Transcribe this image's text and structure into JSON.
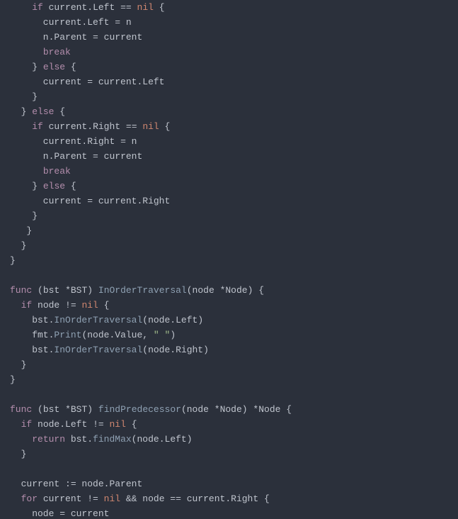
{
  "code_lines": [
    [
      {
        "cls": "tok-id",
        "txt": "    "
      },
      {
        "cls": "tok-kw",
        "txt": "if"
      },
      {
        "cls": "tok-id",
        "txt": " current"
      },
      {
        "cls": "tok-pun",
        "txt": "."
      },
      {
        "cls": "tok-prop",
        "txt": "Left"
      },
      {
        "cls": "tok-id",
        "txt": " "
      },
      {
        "cls": "tok-op",
        "txt": "=="
      },
      {
        "cls": "tok-id",
        "txt": " "
      },
      {
        "cls": "tok-nil",
        "txt": "nil"
      },
      {
        "cls": "tok-id",
        "txt": " "
      },
      {
        "cls": "tok-pun",
        "txt": "{"
      }
    ],
    [
      {
        "cls": "tok-id",
        "txt": "      current"
      },
      {
        "cls": "tok-pun",
        "txt": "."
      },
      {
        "cls": "tok-prop",
        "txt": "Left"
      },
      {
        "cls": "tok-id",
        "txt": " "
      },
      {
        "cls": "tok-op",
        "txt": "="
      },
      {
        "cls": "tok-id",
        "txt": " n"
      }
    ],
    [
      {
        "cls": "tok-id",
        "txt": "      n"
      },
      {
        "cls": "tok-pun",
        "txt": "."
      },
      {
        "cls": "tok-prop",
        "txt": "Parent"
      },
      {
        "cls": "tok-id",
        "txt": " "
      },
      {
        "cls": "tok-op",
        "txt": "="
      },
      {
        "cls": "tok-id",
        "txt": " current"
      }
    ],
    [
      {
        "cls": "tok-id",
        "txt": "      "
      },
      {
        "cls": "tok-kw",
        "txt": "break"
      }
    ],
    [
      {
        "cls": "tok-id",
        "txt": "    "
      },
      {
        "cls": "tok-pun",
        "txt": "}"
      },
      {
        "cls": "tok-id",
        "txt": " "
      },
      {
        "cls": "tok-kw",
        "txt": "else"
      },
      {
        "cls": "tok-id",
        "txt": " "
      },
      {
        "cls": "tok-pun",
        "txt": "{"
      }
    ],
    [
      {
        "cls": "tok-id",
        "txt": "      current "
      },
      {
        "cls": "tok-op",
        "txt": "="
      },
      {
        "cls": "tok-id",
        "txt": " current"
      },
      {
        "cls": "tok-pun",
        "txt": "."
      },
      {
        "cls": "tok-prop",
        "txt": "Left"
      }
    ],
    [
      {
        "cls": "tok-id",
        "txt": "    "
      },
      {
        "cls": "tok-pun",
        "txt": "}"
      }
    ],
    [
      {
        "cls": "tok-id",
        "txt": "  "
      },
      {
        "cls": "tok-pun",
        "txt": "}"
      },
      {
        "cls": "tok-id",
        "txt": " "
      },
      {
        "cls": "tok-kw",
        "txt": "else"
      },
      {
        "cls": "tok-id",
        "txt": " "
      },
      {
        "cls": "tok-pun",
        "txt": "{"
      }
    ],
    [
      {
        "cls": "tok-id",
        "txt": "    "
      },
      {
        "cls": "tok-kw",
        "txt": "if"
      },
      {
        "cls": "tok-id",
        "txt": " current"
      },
      {
        "cls": "tok-pun",
        "txt": "."
      },
      {
        "cls": "tok-prop",
        "txt": "Right"
      },
      {
        "cls": "tok-id",
        "txt": " "
      },
      {
        "cls": "tok-op",
        "txt": "=="
      },
      {
        "cls": "tok-id",
        "txt": " "
      },
      {
        "cls": "tok-nil",
        "txt": "nil"
      },
      {
        "cls": "tok-id",
        "txt": " "
      },
      {
        "cls": "tok-pun",
        "txt": "{"
      }
    ],
    [
      {
        "cls": "tok-id",
        "txt": "      current"
      },
      {
        "cls": "tok-pun",
        "txt": "."
      },
      {
        "cls": "tok-prop",
        "txt": "Right"
      },
      {
        "cls": "tok-id",
        "txt": " "
      },
      {
        "cls": "tok-op",
        "txt": "="
      },
      {
        "cls": "tok-id",
        "txt": " n"
      }
    ],
    [
      {
        "cls": "tok-id",
        "txt": "      n"
      },
      {
        "cls": "tok-pun",
        "txt": "."
      },
      {
        "cls": "tok-prop",
        "txt": "Parent"
      },
      {
        "cls": "tok-id",
        "txt": " "
      },
      {
        "cls": "tok-op",
        "txt": "="
      },
      {
        "cls": "tok-id",
        "txt": " current"
      }
    ],
    [
      {
        "cls": "tok-id",
        "txt": "      "
      },
      {
        "cls": "tok-kw",
        "txt": "break"
      }
    ],
    [
      {
        "cls": "tok-id",
        "txt": "    "
      },
      {
        "cls": "tok-pun",
        "txt": "}"
      },
      {
        "cls": "tok-id",
        "txt": " "
      },
      {
        "cls": "tok-kw",
        "txt": "else"
      },
      {
        "cls": "tok-id",
        "txt": " "
      },
      {
        "cls": "tok-pun",
        "txt": "{"
      }
    ],
    [
      {
        "cls": "tok-id",
        "txt": "      current "
      },
      {
        "cls": "tok-op",
        "txt": "="
      },
      {
        "cls": "tok-id",
        "txt": " current"
      },
      {
        "cls": "tok-pun",
        "txt": "."
      },
      {
        "cls": "tok-prop",
        "txt": "Right"
      }
    ],
    [
      {
        "cls": "tok-id",
        "txt": "    "
      },
      {
        "cls": "tok-pun",
        "txt": "}"
      }
    ],
    [
      {
        "cls": "tok-id",
        "txt": "   "
      },
      {
        "cls": "tok-pun",
        "txt": "}"
      }
    ],
    [
      {
        "cls": "tok-id",
        "txt": "  "
      },
      {
        "cls": "tok-pun",
        "txt": "}"
      }
    ],
    [
      {
        "cls": "tok-pun",
        "txt": "}"
      }
    ],
    [
      {
        "cls": "tok-id",
        "txt": ""
      }
    ],
    [
      {
        "cls": "tok-kw",
        "txt": "func"
      },
      {
        "cls": "tok-id",
        "txt": " "
      },
      {
        "cls": "tok-pun",
        "txt": "("
      },
      {
        "cls": "tok-id",
        "txt": "bst "
      },
      {
        "cls": "tok-op",
        "txt": "*"
      },
      {
        "cls": "tok-type",
        "txt": "BST"
      },
      {
        "cls": "tok-pun",
        "txt": ")"
      },
      {
        "cls": "tok-id",
        "txt": " "
      },
      {
        "cls": "tok-call",
        "txt": "InOrderTraversal"
      },
      {
        "cls": "tok-pun",
        "txt": "("
      },
      {
        "cls": "tok-id",
        "txt": "node "
      },
      {
        "cls": "tok-op",
        "txt": "*"
      },
      {
        "cls": "tok-type",
        "txt": "Node"
      },
      {
        "cls": "tok-pun",
        "txt": ")"
      },
      {
        "cls": "tok-id",
        "txt": " "
      },
      {
        "cls": "tok-pun",
        "txt": "{"
      }
    ],
    [
      {
        "cls": "tok-id",
        "txt": "  "
      },
      {
        "cls": "tok-kw",
        "txt": "if"
      },
      {
        "cls": "tok-id",
        "txt": " node "
      },
      {
        "cls": "tok-op",
        "txt": "!="
      },
      {
        "cls": "tok-id",
        "txt": " "
      },
      {
        "cls": "tok-nil",
        "txt": "nil"
      },
      {
        "cls": "tok-id",
        "txt": " "
      },
      {
        "cls": "tok-pun",
        "txt": "{"
      }
    ],
    [
      {
        "cls": "tok-id",
        "txt": "    bst"
      },
      {
        "cls": "tok-pun",
        "txt": "."
      },
      {
        "cls": "tok-call",
        "txt": "InOrderTraversal"
      },
      {
        "cls": "tok-pun",
        "txt": "("
      },
      {
        "cls": "tok-id",
        "txt": "node"
      },
      {
        "cls": "tok-pun",
        "txt": "."
      },
      {
        "cls": "tok-prop",
        "txt": "Left"
      },
      {
        "cls": "tok-pun",
        "txt": ")"
      }
    ],
    [
      {
        "cls": "tok-id",
        "txt": "    fmt"
      },
      {
        "cls": "tok-pun",
        "txt": "."
      },
      {
        "cls": "tok-call",
        "txt": "Print"
      },
      {
        "cls": "tok-pun",
        "txt": "("
      },
      {
        "cls": "tok-id",
        "txt": "node"
      },
      {
        "cls": "tok-pun",
        "txt": "."
      },
      {
        "cls": "tok-prop",
        "txt": "Value"
      },
      {
        "cls": "tok-pun",
        "txt": ","
      },
      {
        "cls": "tok-id",
        "txt": " "
      },
      {
        "cls": "tok-str",
        "txt": "\" \""
      },
      {
        "cls": "tok-pun",
        "txt": ")"
      }
    ],
    [
      {
        "cls": "tok-id",
        "txt": "    bst"
      },
      {
        "cls": "tok-pun",
        "txt": "."
      },
      {
        "cls": "tok-call",
        "txt": "InOrderTraversal"
      },
      {
        "cls": "tok-pun",
        "txt": "("
      },
      {
        "cls": "tok-id",
        "txt": "node"
      },
      {
        "cls": "tok-pun",
        "txt": "."
      },
      {
        "cls": "tok-prop",
        "txt": "Right"
      },
      {
        "cls": "tok-pun",
        "txt": ")"
      }
    ],
    [
      {
        "cls": "tok-id",
        "txt": "  "
      },
      {
        "cls": "tok-pun",
        "txt": "}"
      }
    ],
    [
      {
        "cls": "tok-pun",
        "txt": "}"
      }
    ],
    [
      {
        "cls": "tok-id",
        "txt": ""
      }
    ],
    [
      {
        "cls": "tok-kw",
        "txt": "func"
      },
      {
        "cls": "tok-id",
        "txt": " "
      },
      {
        "cls": "tok-pun",
        "txt": "("
      },
      {
        "cls": "tok-id",
        "txt": "bst "
      },
      {
        "cls": "tok-op",
        "txt": "*"
      },
      {
        "cls": "tok-type",
        "txt": "BST"
      },
      {
        "cls": "tok-pun",
        "txt": ")"
      },
      {
        "cls": "tok-id",
        "txt": " "
      },
      {
        "cls": "tok-call",
        "txt": "findPredecessor"
      },
      {
        "cls": "tok-pun",
        "txt": "("
      },
      {
        "cls": "tok-id",
        "txt": "node "
      },
      {
        "cls": "tok-op",
        "txt": "*"
      },
      {
        "cls": "tok-type",
        "txt": "Node"
      },
      {
        "cls": "tok-pun",
        "txt": ")"
      },
      {
        "cls": "tok-id",
        "txt": " "
      },
      {
        "cls": "tok-op",
        "txt": "*"
      },
      {
        "cls": "tok-type",
        "txt": "Node"
      },
      {
        "cls": "tok-id",
        "txt": " "
      },
      {
        "cls": "tok-pun",
        "txt": "{"
      }
    ],
    [
      {
        "cls": "tok-id",
        "txt": "  "
      },
      {
        "cls": "tok-kw",
        "txt": "if"
      },
      {
        "cls": "tok-id",
        "txt": " node"
      },
      {
        "cls": "tok-pun",
        "txt": "."
      },
      {
        "cls": "tok-prop",
        "txt": "Left"
      },
      {
        "cls": "tok-id",
        "txt": " "
      },
      {
        "cls": "tok-op",
        "txt": "!="
      },
      {
        "cls": "tok-id",
        "txt": " "
      },
      {
        "cls": "tok-nil",
        "txt": "nil"
      },
      {
        "cls": "tok-id",
        "txt": " "
      },
      {
        "cls": "tok-pun",
        "txt": "{"
      }
    ],
    [
      {
        "cls": "tok-id",
        "txt": "    "
      },
      {
        "cls": "tok-kw",
        "txt": "return"
      },
      {
        "cls": "tok-id",
        "txt": " bst"
      },
      {
        "cls": "tok-pun",
        "txt": "."
      },
      {
        "cls": "tok-call",
        "txt": "findMax"
      },
      {
        "cls": "tok-pun",
        "txt": "("
      },
      {
        "cls": "tok-id",
        "txt": "node"
      },
      {
        "cls": "tok-pun",
        "txt": "."
      },
      {
        "cls": "tok-prop",
        "txt": "Left"
      },
      {
        "cls": "tok-pun",
        "txt": ")"
      }
    ],
    [
      {
        "cls": "tok-id",
        "txt": "  "
      },
      {
        "cls": "tok-pun",
        "txt": "}"
      }
    ],
    [
      {
        "cls": "tok-id",
        "txt": ""
      }
    ],
    [
      {
        "cls": "tok-id",
        "txt": "  current "
      },
      {
        "cls": "tok-op",
        "txt": ":="
      },
      {
        "cls": "tok-id",
        "txt": " node"
      },
      {
        "cls": "tok-pun",
        "txt": "."
      },
      {
        "cls": "tok-prop",
        "txt": "Parent"
      }
    ],
    [
      {
        "cls": "tok-id",
        "txt": "  "
      },
      {
        "cls": "tok-kw",
        "txt": "for"
      },
      {
        "cls": "tok-id",
        "txt": " current "
      },
      {
        "cls": "tok-op",
        "txt": "!="
      },
      {
        "cls": "tok-id",
        "txt": " "
      },
      {
        "cls": "tok-nil",
        "txt": "nil"
      },
      {
        "cls": "tok-id",
        "txt": " "
      },
      {
        "cls": "tok-op",
        "txt": "&&"
      },
      {
        "cls": "tok-id",
        "txt": " node "
      },
      {
        "cls": "tok-op",
        "txt": "=="
      },
      {
        "cls": "tok-id",
        "txt": " current"
      },
      {
        "cls": "tok-pun",
        "txt": "."
      },
      {
        "cls": "tok-prop",
        "txt": "Right"
      },
      {
        "cls": "tok-id",
        "txt": " "
      },
      {
        "cls": "tok-pun",
        "txt": "{"
      }
    ],
    [
      {
        "cls": "tok-id",
        "txt": "    node "
      },
      {
        "cls": "tok-op",
        "txt": "="
      },
      {
        "cls": "tok-id",
        "txt": " current"
      }
    ]
  ]
}
